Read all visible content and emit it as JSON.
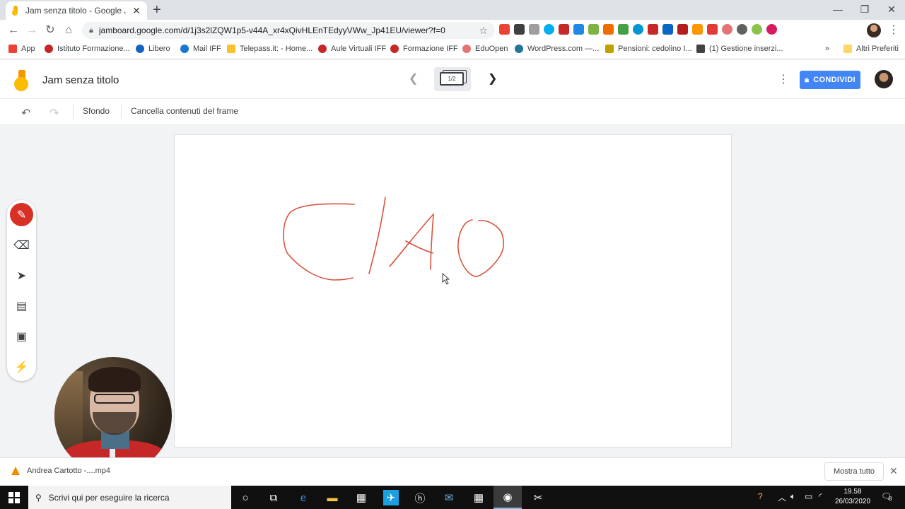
{
  "browser": {
    "tab_title": "Jam senza titolo - Google Jamboard",
    "url": "jamboard.google.com/d/1j3s2lZQW1p5-v44A_xr4xQivHLEnTEdyyVWw_Jp41EU/viewer?f=0",
    "bookmarks": [
      {
        "label": "App",
        "color": "#ea4335"
      },
      {
        "label": "Istituto Formazione...",
        "color": "#c62828"
      },
      {
        "label": "Libero",
        "color": "#1565c0"
      },
      {
        "label": "Mail IFF",
        "color": "#1976d2"
      },
      {
        "label": "Telepass.it: - Home...",
        "color": "#fbc02d"
      },
      {
        "label": "Aule Virtuali IFF",
        "color": "#c62828"
      },
      {
        "label": "Formazione IFF",
        "color": "#c62828"
      },
      {
        "label": "EduOpen",
        "color": "#e57373"
      },
      {
        "label": "WordPress.com —...",
        "color": "#21759b"
      },
      {
        "label": "Pensioni: cedolino I...",
        "color": "#c0a000"
      },
      {
        "label": "(1) Gestione inserzi...",
        "color": "#424242"
      }
    ],
    "bookmarks_overflow": "»",
    "other_bookmarks": "Altri Preferiti"
  },
  "jamboard": {
    "title": "Jam senza titolo",
    "frame_counter": "1/2",
    "share_label": "CONDIVIDI",
    "toolbar": {
      "background_label": "Sfondo",
      "clear_frame_label": "Cancella contenuti del frame"
    },
    "accent_color": "#4285f4",
    "pen_color": "#d93025"
  },
  "downloads": {
    "item_label": "Andrea Cartotto -....mp4",
    "show_all_label": "Mostra tutto"
  },
  "taskbar": {
    "search_placeholder": "Scrivi qui per eseguire la ricerca",
    "time": "19.58",
    "date": "26/03/2020",
    "notification_count": "8"
  }
}
